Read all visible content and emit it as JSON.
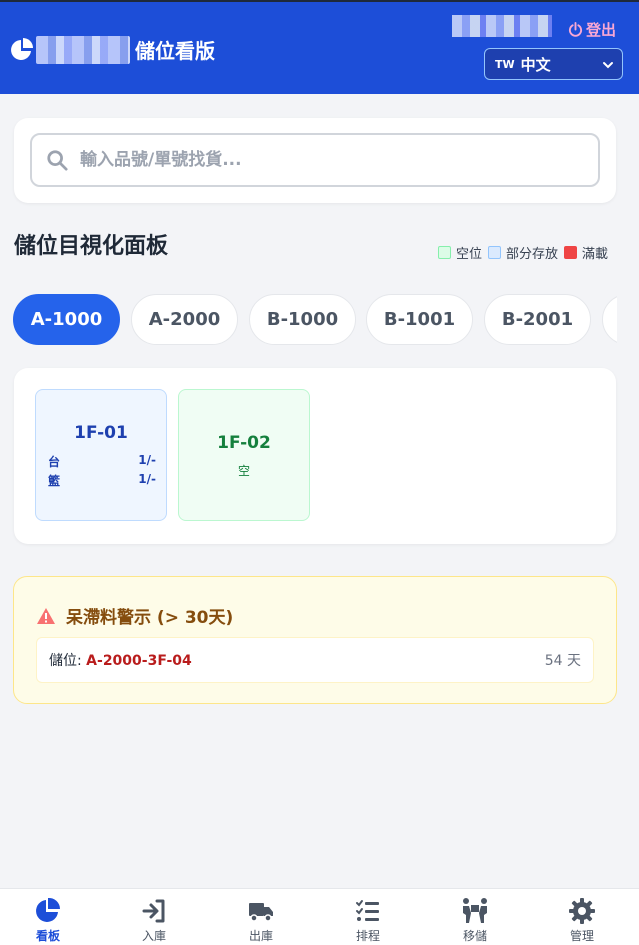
{
  "header": {
    "title": "儲位看版",
    "logout_label": "登出",
    "language": {
      "flag": "TW",
      "label": "中文"
    }
  },
  "search": {
    "placeholder": "輸入品號/單號找貨..."
  },
  "board": {
    "title": "儲位目視化面板",
    "legend": [
      {
        "label": "空位",
        "color": "#dcfce7",
        "border": "#86efac"
      },
      {
        "label": "部分存放",
        "color": "#dbeafe",
        "border": "#93c5fd"
      },
      {
        "label": "滿載",
        "color": "#ef4444",
        "border": "#ef4444"
      }
    ],
    "tabs": [
      "A-1000",
      "A-2000",
      "B-1000",
      "B-1001",
      "B-2001"
    ],
    "active_tab": "A-1000",
    "slots": [
      {
        "code": "1F-01",
        "status": "partial",
        "rows": [
          {
            "label": "台",
            "value": "1/-"
          },
          {
            "label": "籃",
            "value": "1/-"
          }
        ]
      },
      {
        "code": "1F-02",
        "status": "empty",
        "status_label": "空"
      }
    ]
  },
  "alert": {
    "title": "呆滯料警示 (> 30天)",
    "items": [
      {
        "label": "儲位:",
        "location": "A-2000-3F-04",
        "days": "54 天"
      }
    ]
  },
  "nav": {
    "items": [
      {
        "label": "看板",
        "icon": "pie-chart-icon",
        "active": true
      },
      {
        "label": "入庫",
        "icon": "sign-in-icon"
      },
      {
        "label": "出庫",
        "icon": "truck-icon"
      },
      {
        "label": "排程",
        "icon": "task-list-icon"
      },
      {
        "label": "移儲",
        "icon": "people-carry-icon"
      },
      {
        "label": "管理",
        "icon": "gear-icon"
      }
    ]
  },
  "colors": {
    "primary": "#1d4ed8",
    "accent": "#2563eb",
    "danger": "#b91c1c",
    "warning_bg": "#fefce8"
  }
}
